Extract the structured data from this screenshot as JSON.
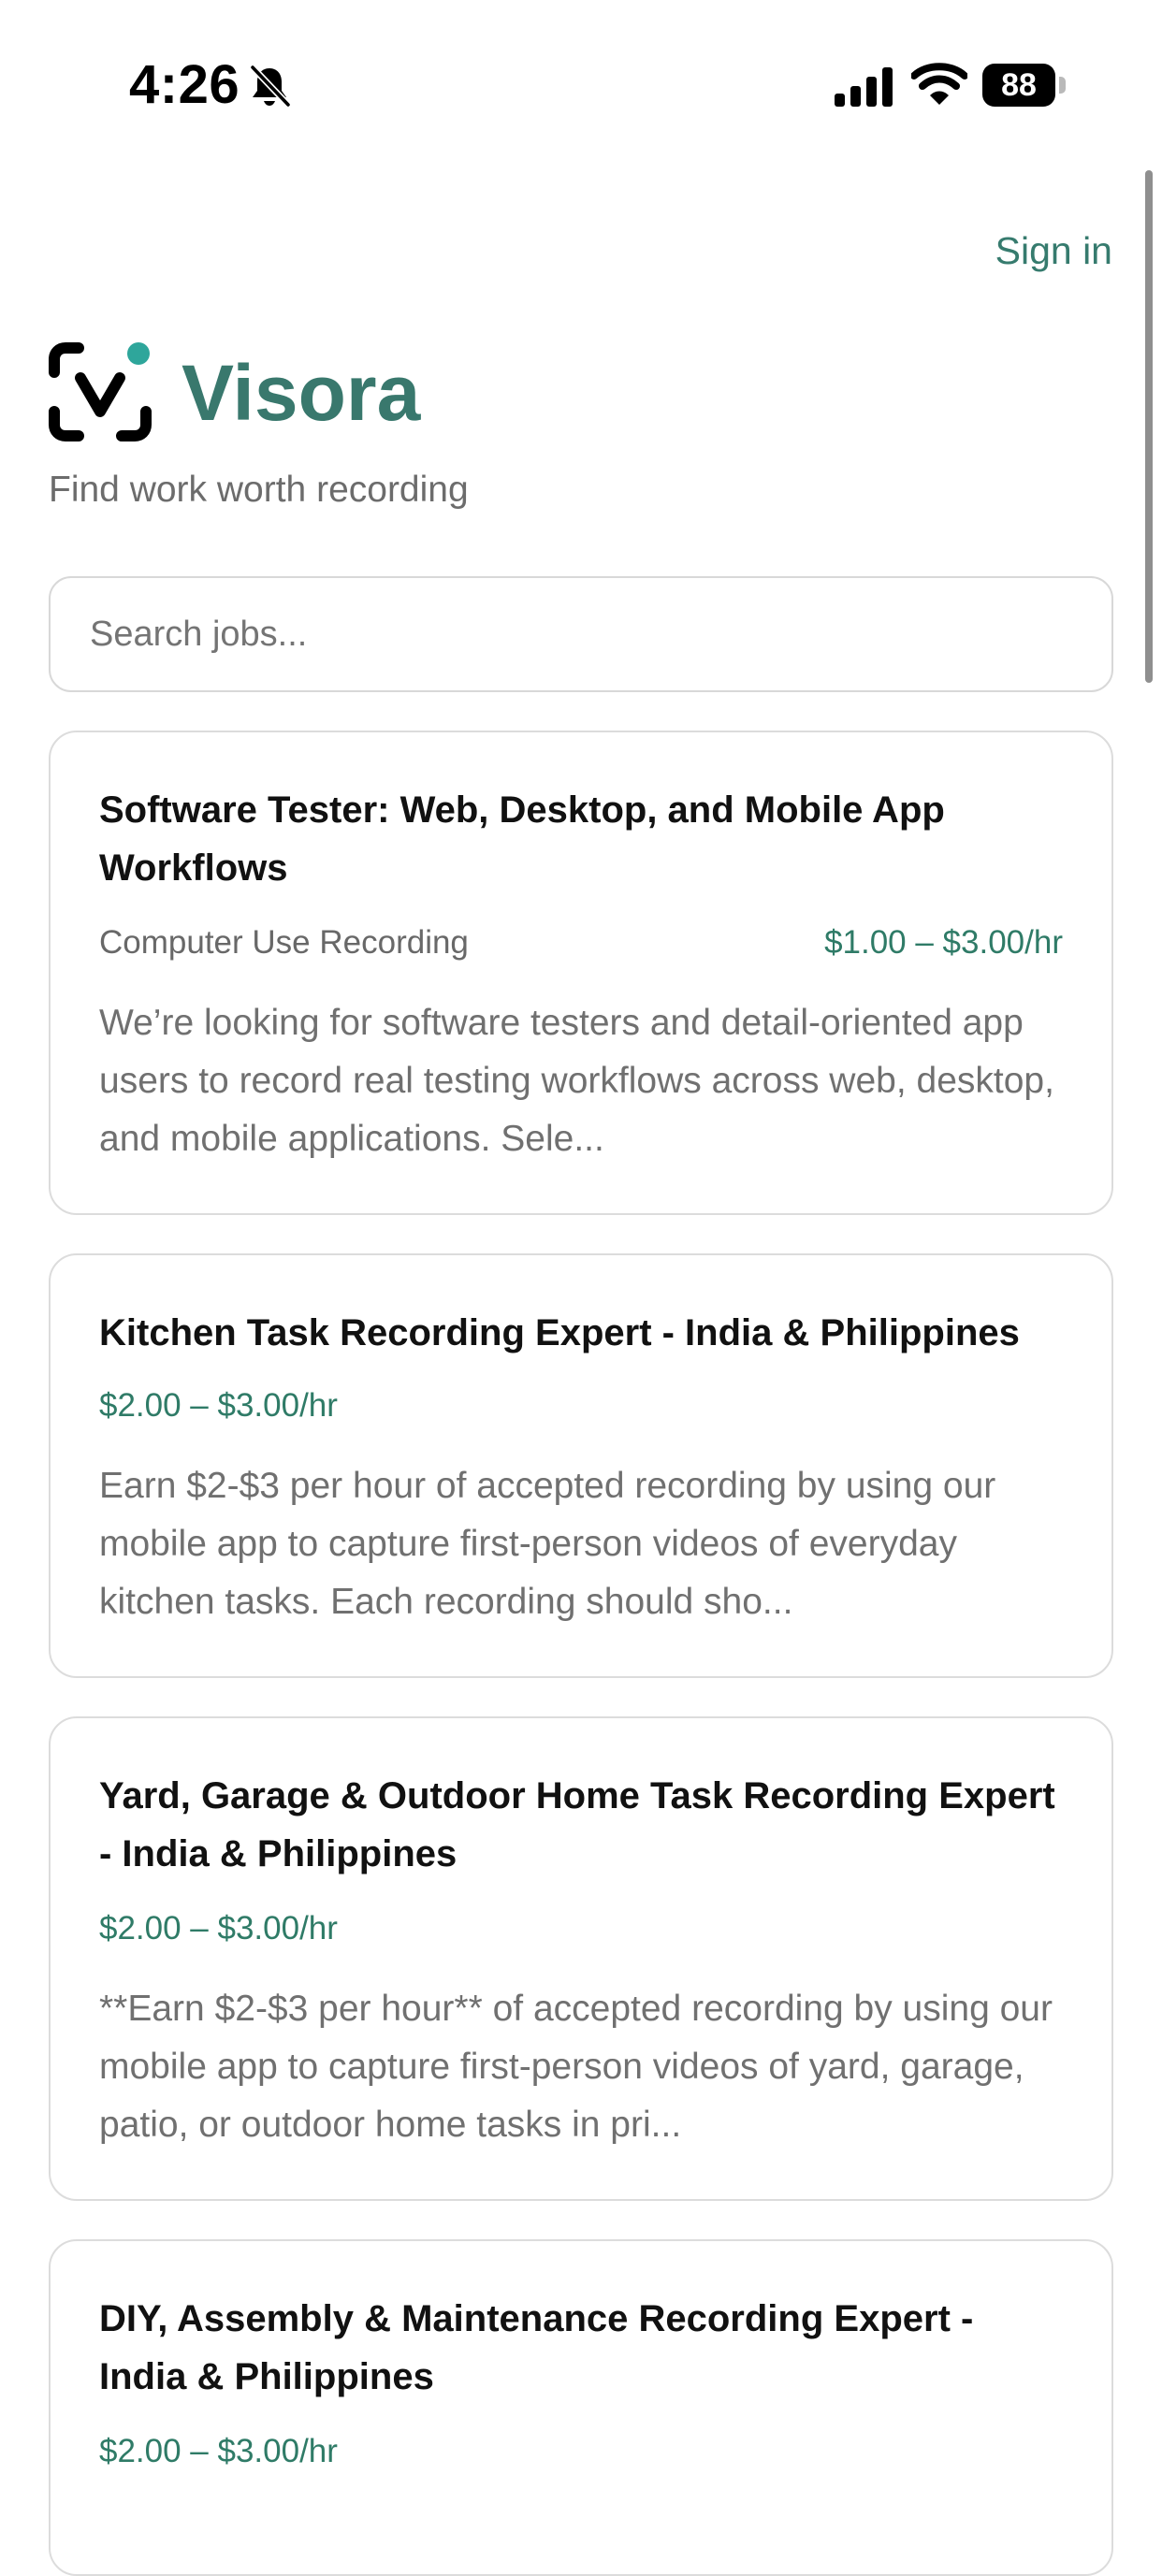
{
  "status_bar": {
    "time": "4:26",
    "battery": "88",
    "icons": [
      "bell-off-icon",
      "signal-icon",
      "wifi-icon",
      "battery-icon"
    ]
  },
  "header": {
    "sign_in_label": "Sign in"
  },
  "brand": {
    "logo_icon": "visora-logo-icon",
    "name": "Visora",
    "tagline": "Find work worth recording"
  },
  "search": {
    "placeholder": "Search jobs...",
    "value": ""
  },
  "jobs": [
    {
      "title": "Software Tester: Web, Desktop, and Mobile App Workflows",
      "category": "Computer Use Recording",
      "rate": "$1.00 – $3.00/hr",
      "description": "We’re looking for software testers and detail-oriented app users to record real testing workflows across web, desktop, and mobile applications. Sele..."
    },
    {
      "title": "Kitchen Task Recording Expert - India & Philippines",
      "rate": "$2.00 – $3.00/hr",
      "description": "Earn $2-$3 per hour of accepted recording by using our mobile app to capture first-person videos of everyday kitchen tasks. Each recording should sho..."
    },
    {
      "title": "Yard, Garage & Outdoor Home Task Recording Expert - India & Philippines",
      "rate": "$2.00 – $3.00/hr",
      "description": "**Earn $2-$3 per hour** of accepted recording by using our mobile app to capture first-person videos of yard, garage, patio, or outdoor home tasks in pri..."
    },
    {
      "title": "DIY, Assembly & Maintenance Recording Expert - India & Philippines",
      "rate": "$2.00 – $3.00/hr"
    }
  ],
  "colors": {
    "accent": "#39786d",
    "rate": "#2f7b67",
    "logo_dot": "#2ea69b",
    "card_border": "#dcdcdc"
  }
}
